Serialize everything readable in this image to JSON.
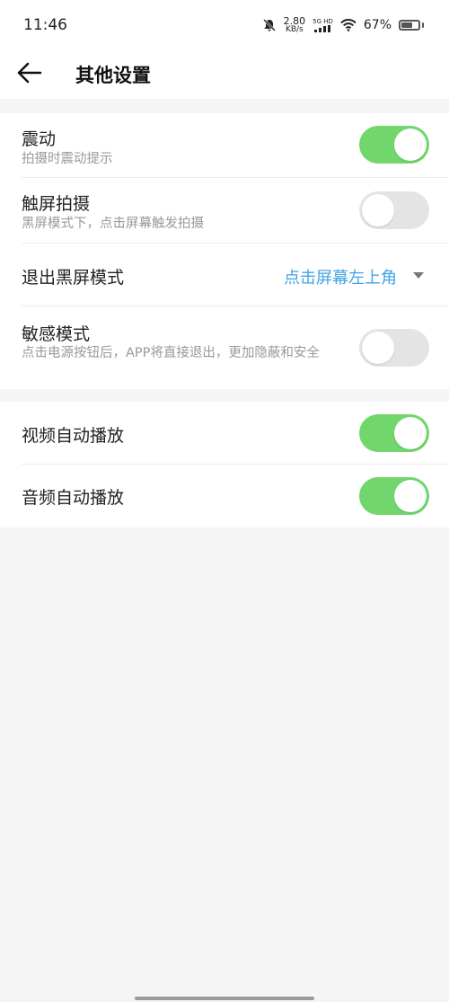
{
  "status_bar": {
    "time": "11:46",
    "net_speed_value": "2.80",
    "net_speed_unit": "KB/s",
    "signal_label": "5G HD",
    "battery_percent": "67%",
    "battery_level": 0.67
  },
  "header": {
    "title": "其他设置"
  },
  "settings": {
    "vibration": {
      "title": "震动",
      "subtitle": "拍摄时震动提示",
      "enabled": true
    },
    "touch_capture": {
      "title": "触屏拍摄",
      "subtitle": "黑屏模式下，点击屏幕触发拍摄",
      "enabled": false
    },
    "exit_black_screen": {
      "title": "退出黑屏模式",
      "value": "点击屏幕左上角"
    },
    "sensitive_mode": {
      "title": "敏感模式",
      "subtitle": "点击电源按钮后，APP将直接退出，更加隐蔽和安全",
      "enabled": false
    },
    "video_autoplay": {
      "title": "视频自动播放",
      "enabled": true
    },
    "audio_autoplay": {
      "title": "音频自动播放",
      "enabled": true
    }
  },
  "colors": {
    "toggle_on": "#71d66c",
    "toggle_off": "#e4e4e4",
    "accent": "#3ea4e6",
    "background": "#f5f5f5"
  }
}
